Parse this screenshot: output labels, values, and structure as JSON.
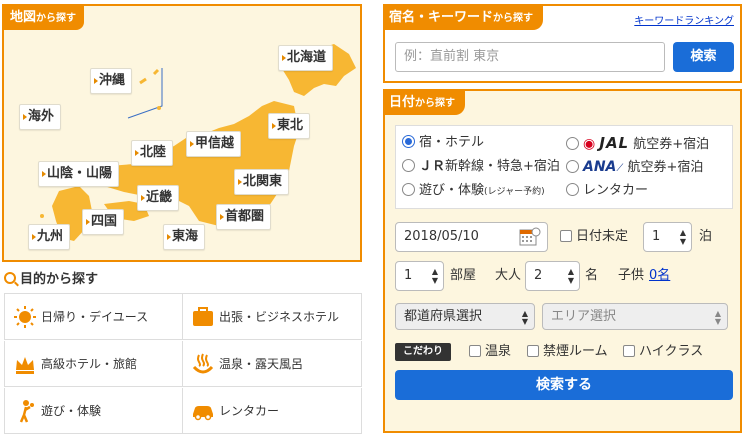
{
  "map_section": {
    "title": "地図",
    "title_suffix": "から探す",
    "regions": {
      "hokkaido": "北海道",
      "okinawa": "沖縄",
      "kaigai": "海外",
      "tohoku": "東北",
      "koshinetsu": "甲信越",
      "hokuriku": "北陸",
      "sanin_sanyo": "山陰・山陽",
      "kitakanto": "北関東",
      "kinki": "近畿",
      "shikoku": "四国",
      "kyushu": "九州",
      "shutoken": "首都圏",
      "tokai": "東海"
    }
  },
  "purpose_section": {
    "title": "目的から探す",
    "items": [
      {
        "label": "日帰り・デイユース",
        "icon": "sun-icon"
      },
      {
        "label": "出張・ビジネスホテル",
        "icon": "briefcase-icon"
      },
      {
        "label": "高級ホテル・旅館",
        "icon": "crown-icon"
      },
      {
        "label": "温泉・露天風呂",
        "icon": "hot-spring-icon"
      },
      {
        "label": "遊び・体験",
        "icon": "activity-icon"
      },
      {
        "label": "レンタカー",
        "icon": "car-icon"
      }
    ]
  },
  "keyword_section": {
    "title": "宿名・キーワード",
    "title_suffix": "から探す",
    "ranking_link": "キーワードランキング",
    "placeholder": "例：直前割 東京",
    "search_button": "検索"
  },
  "date_section": {
    "title": "日付",
    "title_suffix": "から探す",
    "types": {
      "hotel": "宿・ホテル",
      "jal_logo": "JAL",
      "jal_label": "航空券+宿泊",
      "jr_logo": "ＪＲ",
      "jr_label": "新幹線・特急+宿泊",
      "ana_logo": "ANA",
      "ana_label": "航空券+宿泊",
      "play": "遊び・体験",
      "play_note": "(レジャー予約)",
      "rentacar": "レンタカー"
    },
    "selected_type": "hotel",
    "date_value": "2018/05/10",
    "date_undecided": "日付未定",
    "nights_value": "1",
    "nights_unit": "泊",
    "rooms_value": "1",
    "rooms_unit": "部屋",
    "adults_label": "大人",
    "adults_value": "2",
    "adults_unit": "名",
    "children_label": "子供",
    "children_value": "0名",
    "prefecture_select": "都道府県選択",
    "area_select": "エリア選択",
    "kodawari_label": "こだわり",
    "options": {
      "onsen": "温泉",
      "nonsmoking": "禁煙ルーム",
      "highclass": "ハイクラス"
    },
    "submit_button": "検索する"
  },
  "colors": {
    "accent_orange": "#f08c00",
    "button_blue": "#1a6dd8",
    "map_land": "#f7b733",
    "map_bg": "#fdf6df"
  }
}
